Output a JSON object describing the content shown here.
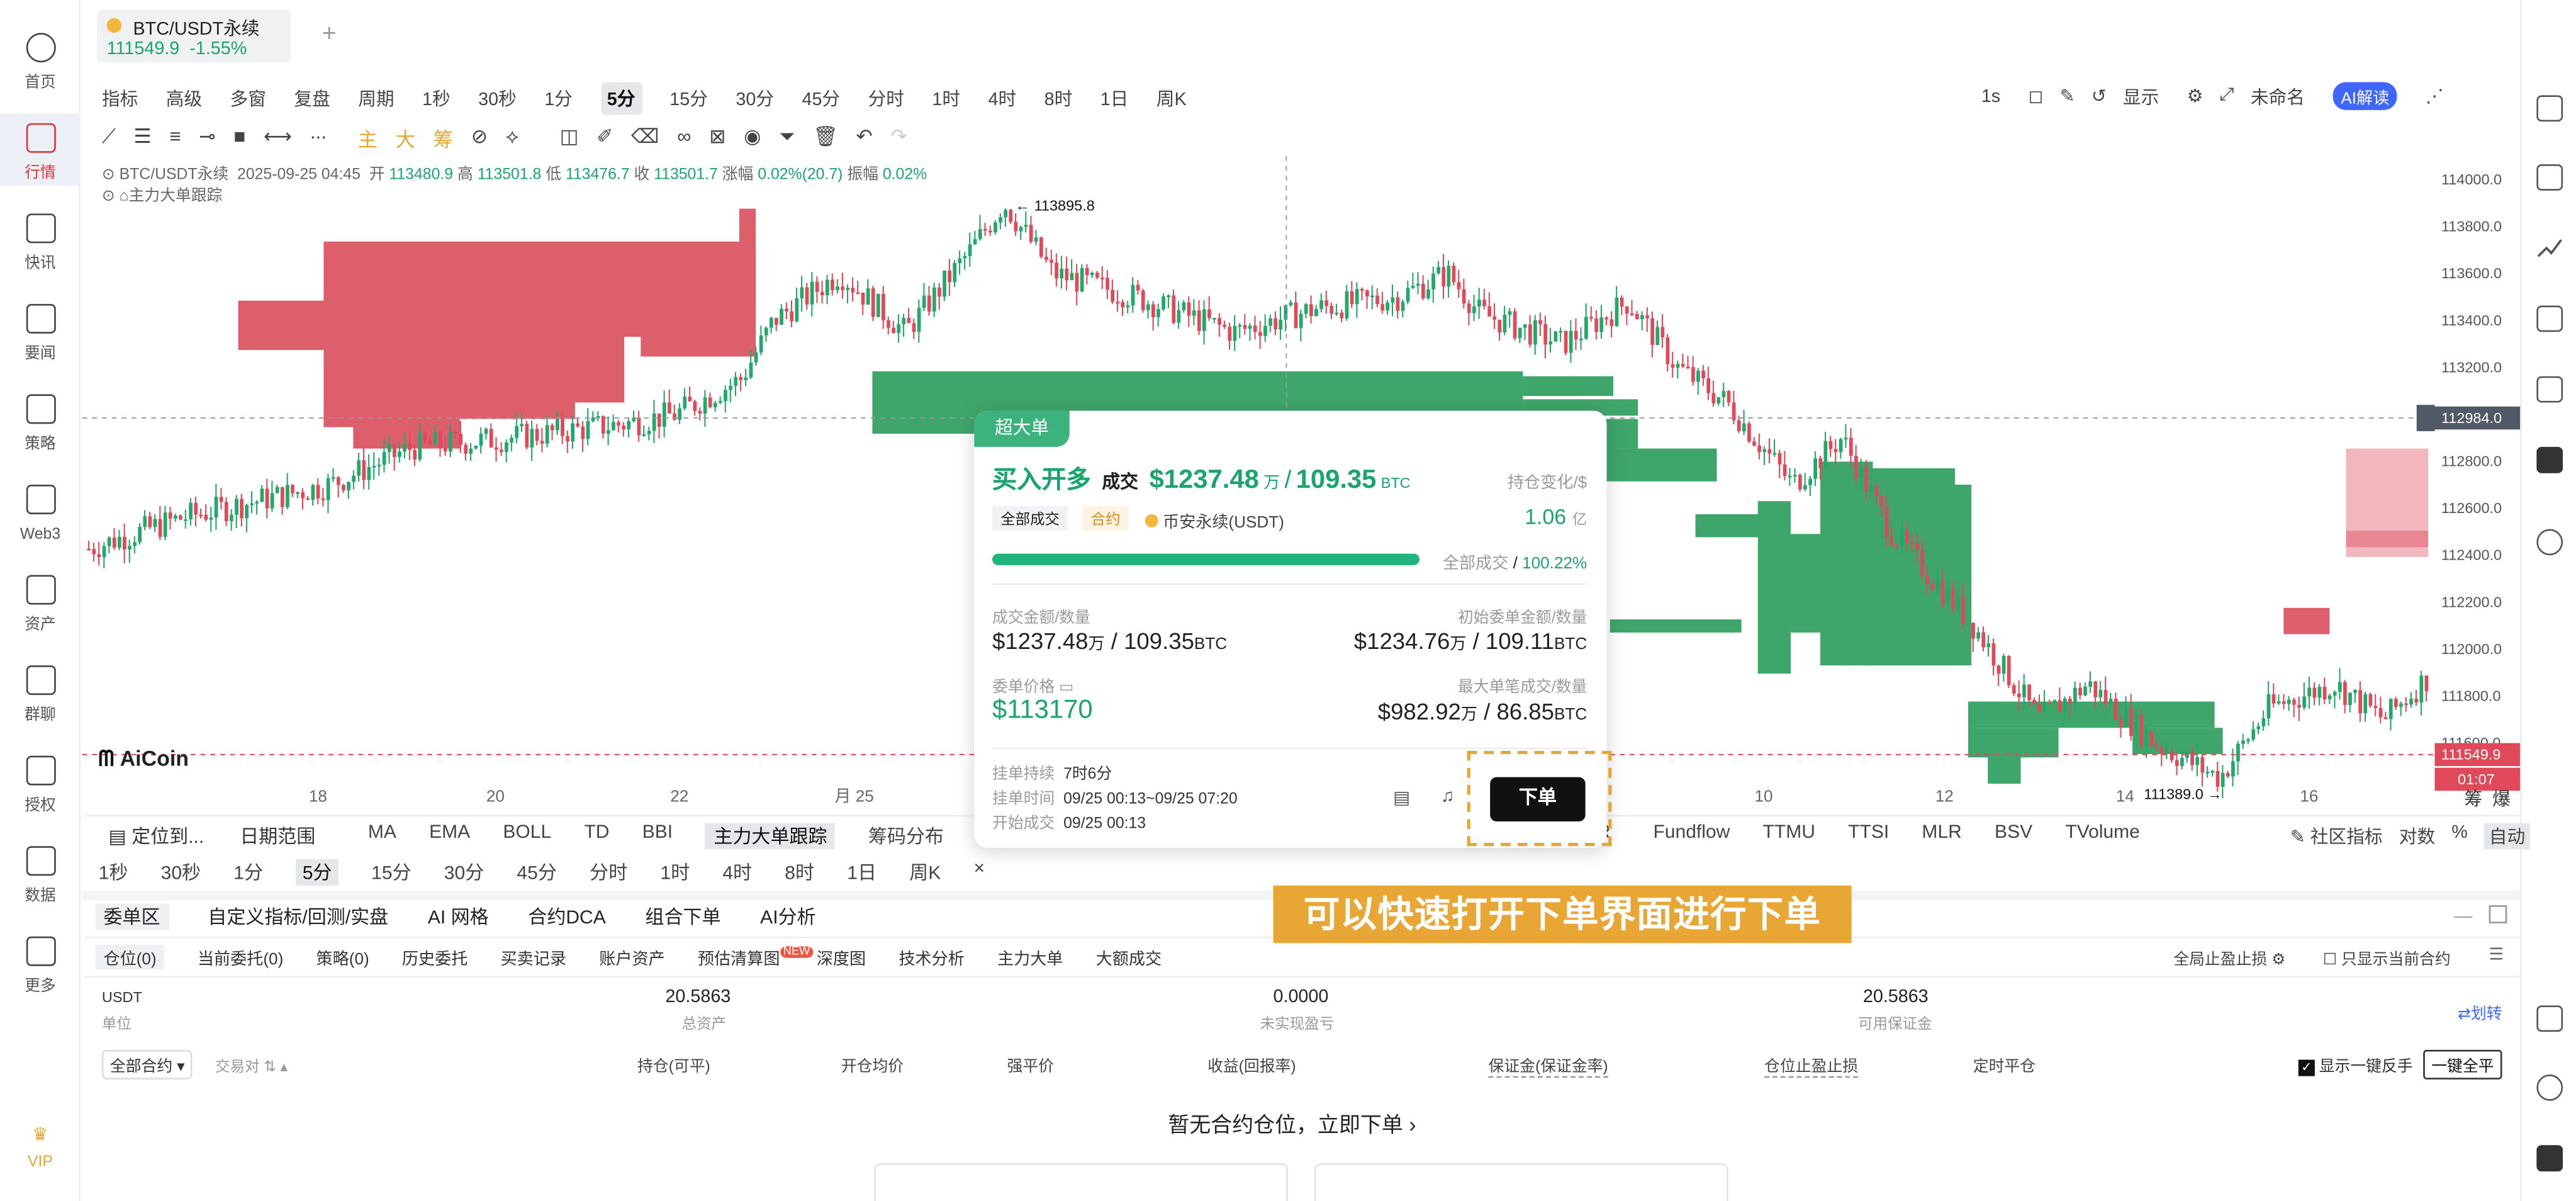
{
  "nav": [
    {
      "label": "首页",
      "icon": "home-icon"
    },
    {
      "label": "行情",
      "icon": "market-icon"
    },
    {
      "label": "快讯",
      "icon": "news-flash-icon"
    },
    {
      "label": "要闻",
      "icon": "headline-icon"
    },
    {
      "label": "策略",
      "icon": "robot-icon"
    },
    {
      "label": "Web3",
      "icon": "web3-icon"
    },
    {
      "label": "资产",
      "icon": "wallet-icon"
    },
    {
      "label": "群聊",
      "icon": "chat-icon"
    },
    {
      "label": "授权",
      "icon": "auth-icon"
    },
    {
      "label": "数据",
      "icon": "data-icon"
    },
    {
      "label": "更多",
      "icon": "more-icon"
    }
  ],
  "vip": "VIP",
  "tab": {
    "symbol": "BTC/USDT永续",
    "price": "111549.9",
    "change": "-1.55%",
    "add": "+"
  },
  "toolbar": {
    "items": [
      "指标",
      "高级",
      "多窗",
      "复盘",
      "周期",
      "1秒",
      "30秒",
      "1分",
      "5分",
      "15分",
      "30分",
      "45分",
      "分时",
      "1时",
      "4时",
      "8时",
      "1日",
      "周K"
    ],
    "selected": "5分",
    "right": [
      "1s",
      "显示",
      "未命名",
      "AI解读"
    ]
  },
  "draw_tools": [
    "主",
    "大",
    "筹"
  ],
  "info": {
    "symbol": "BTC/USDT永续",
    "time": "2025-09-25 04:45",
    "open_l": "开",
    "open": "113480.9",
    "high_l": "高",
    "high": "113501.8",
    "low_l": "低",
    "low": "113476.7",
    "close_l": "收",
    "close": "113501.7",
    "chg_l": "涨幅",
    "chg": "0.02%(20.7)",
    "amp_l": "振幅",
    "amp": "0.02%",
    "indicator": "主力大单跟踪"
  },
  "price_axis": [
    "114000.0",
    "113800.0",
    "113600.0",
    "113400.0",
    "113200.0",
    "112800.0",
    "112600.0",
    "112400.0",
    "112200.0",
    "112000.0",
    "111800.0",
    "111600.0"
  ],
  "price_tags": {
    "cross": "112984.0",
    "last": "111549.9",
    "countdown": "01:07",
    "high_mark": "113895.8",
    "low_mark": "111389.0"
  },
  "time_axis": [
    "18",
    "20",
    "22",
    "月 25",
    "10",
    "12",
    "14",
    "16"
  ],
  "chart_data": {
    "type": "candlestick",
    "symbol": "BTC/USDT永续",
    "interval": "5分",
    "ylim": [
      111300,
      114100
    ],
    "annotations": {
      "high": 113895.8,
      "low": 111389.0,
      "last": 111549.9,
      "cross": 112984.0
    }
  },
  "logo": "AiCoin",
  "chart_right": [
    "筹",
    "爆"
  ],
  "indicator_bar": {
    "left": [
      "定位到...",
      "日期范围"
    ],
    "items": [
      "MA",
      "EMA",
      "BOLL",
      "TD",
      "BBI",
      "主力大单跟踪",
      "筹码分布"
    ],
    "more": [
      "R",
      "Fundflow",
      "TTMU",
      "TTSI",
      "MLR",
      "BSV",
      "TVolume"
    ],
    "right": [
      "社区指标",
      "对数",
      "%",
      "自动"
    ]
  },
  "period_bar": [
    "1秒",
    "30秒",
    "1分",
    "5分",
    "15分",
    "30分",
    "45分",
    "分时",
    "1时",
    "4时",
    "8时",
    "1日",
    "周K",
    "×"
  ],
  "bottom": {
    "tabs": [
      "委单区",
      "自定义指标/回测/实盘",
      "AI 网格",
      "合约DCA",
      "组合下单",
      "AI分析"
    ],
    "subtabs": [
      "仓位(0)",
      "当前委托(0)",
      "策略(0)",
      "历史委托",
      "买卖记录",
      "账户资产",
      "预估清算图",
      "深度图",
      "技术分析",
      "主力大单",
      "大额成交"
    ],
    "new_badge": "NEW",
    "right_links": [
      "全局止盈止损",
      "只显示当前合约"
    ],
    "usdt": "USDT",
    "unit": "单位",
    "total_v": "20.5863",
    "total_l": "总资产",
    "pnl_v": "0.0000",
    "pnl_l": "未实现盈亏",
    "avail_v": "20.5863",
    "avail_l": "可用保证金",
    "transfer": "划转",
    "cols": [
      "全部合约",
      "交易对",
      "持仓(可平)",
      "开仓均价",
      "强平价",
      "收益(回报率)",
      "保证金(保证金率)",
      "仓位止盈止损",
      "定时平仓"
    ],
    "oneclick_l": "显示一键反手",
    "oneclick_btn": "一键全平",
    "empty": "暂无合约仓位，立即下单"
  },
  "popup": {
    "badge": "超大单",
    "side": "买入开多",
    "deal": "成交",
    "amount": "$1237.48",
    "amount_unit": "万",
    "sep": "/",
    "qty": "109.35",
    "qty_unit": "BTC",
    "pos_change": "持仓变化/$",
    "tag1": "全部成交",
    "tag2": "合约",
    "exchange": "币安永续(USDT)",
    "pos_val": "1.06",
    "pos_unit": "亿",
    "progress": 1.0,
    "progress_l": "全部成交",
    "progress_pct": "100.22%",
    "l1": "成交金额/数量",
    "v1a": "$1237.48",
    "v1u": "万",
    "v1b": "109.35",
    "r1": "初始委单金额/数量",
    "w1a": "$1234.76",
    "w1b": "109.11",
    "l2": "委单价格",
    "v2": "$113170",
    "r2": "最大单笔成交/数量",
    "w2a": "$982.92",
    "w2b": "86.85",
    "t1l": "挂单持续",
    "t1": "7时6分",
    "t2l": "挂单时间",
    "t2": "09/25 00:13~09/25 07:20",
    "t3l": "开始成交",
    "t3": "09/25 00:13",
    "order": "下单"
  },
  "overlay_text": "可以快速打开下单界面进行下单"
}
